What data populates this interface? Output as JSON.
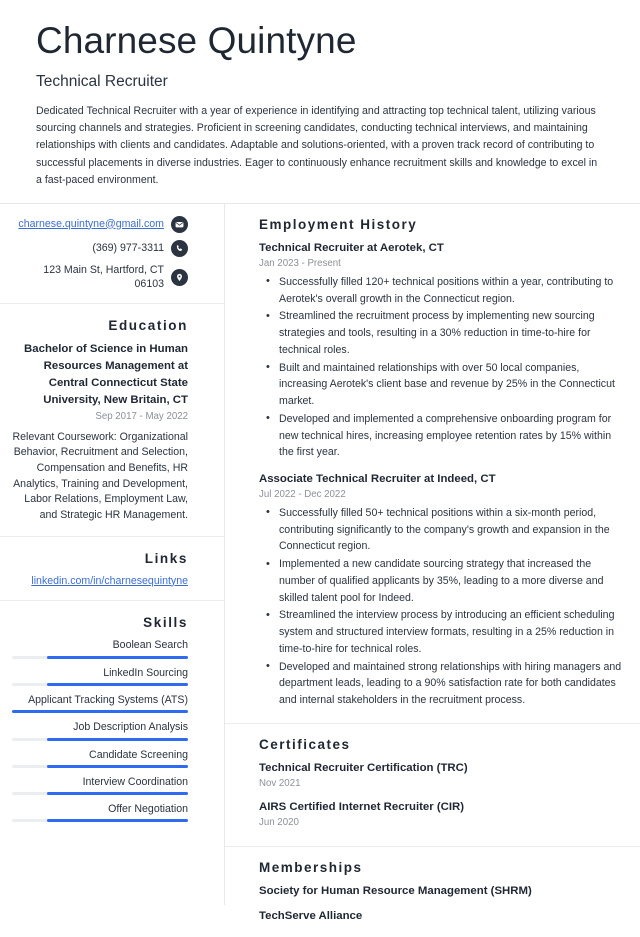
{
  "header": {
    "name": "Charnese Quintyne",
    "job_title": "Technical Recruiter",
    "summary": "Dedicated Technical Recruiter with a year of experience in identifying and attracting top technical talent, utilizing various sourcing channels and strategies. Proficient in screening candidates, conducting technical interviews, and maintaining relationships with clients and candidates. Adaptable and solutions-oriented, with a proven track record of contributing to successful placements in diverse industries. Eager to continuously enhance recruitment skills and knowledge to excel in a fast-paced environment."
  },
  "contact": {
    "email": "charnese.quintyne@gmail.com",
    "phone": "(369) 977-3311",
    "address": "123 Main St, Hartford, CT 06103",
    "email_icon": "envelope-icon",
    "phone_icon": "phone-icon",
    "address_icon": "location-pin-icon"
  },
  "education": {
    "heading": "Education",
    "degree": "Bachelor of Science in Human Resources Management at Central Connecticut State University, New Britain, CT",
    "date": "Sep 2017 - May 2022",
    "description": "Relevant Coursework: Organizational Behavior, Recruitment and Selection, Compensation and Benefits, HR Analytics, Training and Development, Labor Relations, Employment Law, and Strategic HR Management."
  },
  "links": {
    "heading": "Links",
    "items": [
      {
        "label": "linkedin.com/in/charnesequintyne"
      }
    ]
  },
  "skills": {
    "heading": "Skills",
    "accent_color": "#2f6bf0",
    "track_color": "#ebedf0",
    "items": [
      {
        "label": "Boolean Search",
        "level": 80
      },
      {
        "label": "LinkedIn Sourcing",
        "level": 80
      },
      {
        "label": "Applicant Tracking Systems (ATS)",
        "level": 100
      },
      {
        "label": "Job Description Analysis",
        "level": 80
      },
      {
        "label": "Candidate Screening",
        "level": 80
      },
      {
        "label": "Interview Coordination",
        "level": 80
      },
      {
        "label": "Offer Negotiation",
        "level": 80
      }
    ]
  },
  "employment": {
    "heading": "Employment History",
    "entries": [
      {
        "title": "Technical Recruiter at Aerotek, CT",
        "date": "Jan 2023 - Present",
        "bullets": [
          "Successfully filled 120+ technical positions within a year, contributing to Aerotek's overall growth in the Connecticut region.",
          "Streamlined the recruitment process by implementing new sourcing strategies and tools, resulting in a 30% reduction in time-to-hire for technical roles.",
          "Built and maintained relationships with over 50 local companies, increasing Aerotek's client base and revenue by 25% in the Connecticut market.",
          "Developed and implemented a comprehensive onboarding program for new technical hires, increasing employee retention rates by 15% within the first year."
        ]
      },
      {
        "title": "Associate Technical Recruiter at Indeed, CT",
        "date": "Jul 2022 - Dec 2022",
        "bullets": [
          "Successfully filled 50+ technical positions within a six-month period, contributing significantly to the company's growth and expansion in the Connecticut region.",
          "Implemented a new candidate sourcing strategy that increased the number of qualified applicants by 35%, leading to a more diverse and skilled talent pool for Indeed.",
          "Streamlined the interview process by introducing an efficient scheduling system and structured interview formats, resulting in a 25% reduction in time-to-hire for technical roles.",
          "Developed and maintained strong relationships with hiring managers and department leads, leading to a 90% satisfaction rate for both candidates and internal stakeholders in the recruitment process."
        ]
      }
    ]
  },
  "certificates": {
    "heading": "Certificates",
    "entries": [
      {
        "title": "Technical Recruiter Certification (TRC)",
        "date": "Nov 2021"
      },
      {
        "title": "AIRS Certified Internet Recruiter (CIR)",
        "date": "Jun 2020"
      }
    ]
  },
  "memberships": {
    "heading": "Memberships",
    "entries": [
      {
        "title": "Society for Human Resource Management (SHRM)"
      },
      {
        "title": "TechServe Alliance"
      }
    ]
  }
}
